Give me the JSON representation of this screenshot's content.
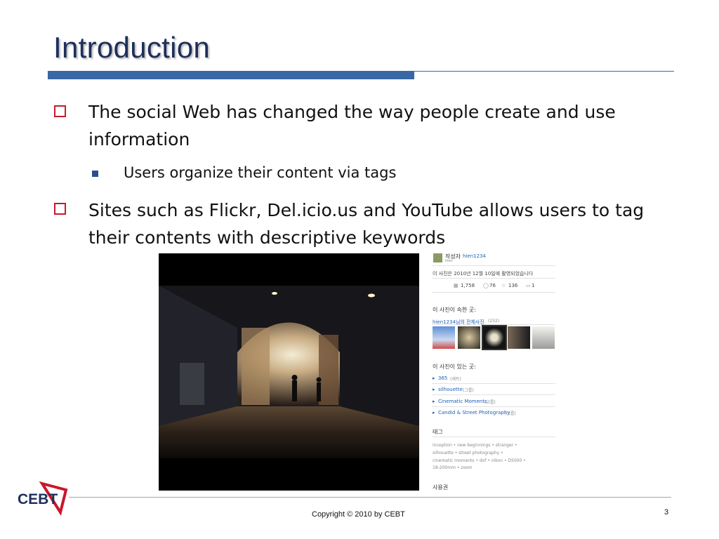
{
  "slide": {
    "title": "Introduction",
    "bullets": [
      {
        "text_line1": "The social Web has changed the way people create and use",
        "text_line2": "information"
      },
      {
        "text_line1": "Sites such as Flickr, Del.icio.us and YouTube allows users to tag",
        "text_line2": "their contents with descriptive keywords"
      }
    ],
    "sub_bullet": "Users organize their content via tags"
  },
  "flickr_panel": {
    "author_label": "작성자",
    "author_id": "hien1234",
    "author_name": "hien",
    "date_text": "이 사진은 2010년 12월 10일에 촬영되었습니다",
    "stats": {
      "views": "1,758",
      "comments": "76",
      "favorites": "136",
      "notes": "1"
    },
    "belongs_header": "이 사진이 속한 곳:",
    "photostream": "hien1234님의 전체사진",
    "photostream_count": "(232)",
    "in_header": "이 사진이 있는 곳:",
    "sets": [
      {
        "name": "365",
        "kind": "(세트)"
      },
      {
        "name": "silhouette",
        "kind": "(그룹)"
      },
      {
        "name": "Cinematic Moments.",
        "kind": "(그룹)"
      },
      {
        "name": "Candid & Street Photography",
        "kind": "(그룹)"
      }
    ],
    "tags_header": "태그",
    "tags_line1": "inception  •  new beginnings  •  stranger  •",
    "tags_line2": "silhouette  •  street photography  •",
    "tags_line3": "cinematic moments  •  dof  •  nikon  •  D5000  •",
    "tags_line4": "18-200mm  •  zoom",
    "license_header": "사용권"
  },
  "footer": {
    "logo_text": "CEBT",
    "copyright": "Copyright © 2010 by CEBT",
    "page_number": "3"
  },
  "colors": {
    "title": "#1f2f5c",
    "title_bar": "#3868a6",
    "bullet_box": "#c8182d",
    "sub_bullet": "#2a4f8c",
    "link": "#1f5fb8"
  }
}
